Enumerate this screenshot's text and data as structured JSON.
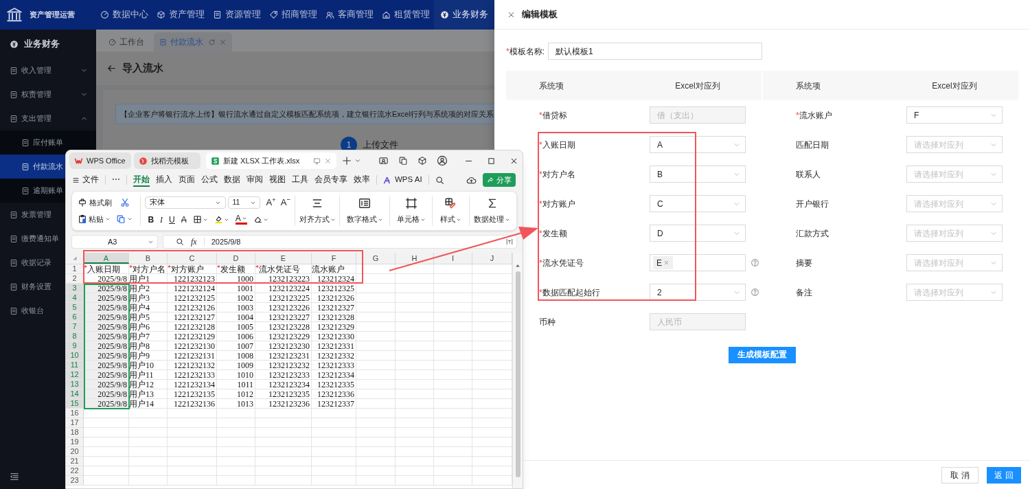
{
  "app": {
    "brand": "资产管理运营",
    "nav": [
      {
        "label": "数据中心",
        "selected": false
      },
      {
        "label": "资产管理",
        "selected": false
      },
      {
        "label": "资源管理",
        "selected": false
      },
      {
        "label": "招商管理",
        "selected": false
      },
      {
        "label": "客商管理",
        "selected": false
      },
      {
        "label": "租赁管理",
        "selected": false
      },
      {
        "label": "业务财务",
        "selected": true
      }
    ],
    "sidebar": {
      "header": "业务财务",
      "items": [
        {
          "label": "收入管理",
          "kind": "group",
          "expanded": false,
          "selected": false
        },
        {
          "label": "权责管理",
          "kind": "group",
          "expanded": false,
          "selected": false
        },
        {
          "label": "支出管理",
          "kind": "group",
          "expanded": true,
          "selected": false,
          "children": [
            {
              "label": "应付账单",
              "selected": false
            },
            {
              "label": "付款流水",
              "selected": true
            },
            {
              "label": "逾期账单",
              "selected": false
            }
          ]
        },
        {
          "label": "发票管理",
          "kind": "leaf",
          "selected": false
        },
        {
          "label": "缴费通知单",
          "kind": "leaf",
          "selected": false
        },
        {
          "label": "收据记录",
          "kind": "leaf",
          "selected": false
        },
        {
          "label": "财务设置",
          "kind": "leaf",
          "selected": false
        },
        {
          "label": "收银台",
          "kind": "leaf",
          "selected": false
        }
      ]
    },
    "tabs": [
      {
        "label": "工作台",
        "selected": false
      },
      {
        "label": "付款流水",
        "selected": true
      }
    ],
    "page_title": "导入流水",
    "notice": "【企业客户将银行流水上传】银行流水通过自定义模板匹配系统项，建立银行流水Excel行列与系统项的对应关系",
    "step": {
      "number": "1",
      "label": "上传文件"
    }
  },
  "wps": {
    "window_tabs": [
      {
        "label": "WPS Office",
        "selected": false
      },
      {
        "label": "找稻壳模板",
        "selected": false
      },
      {
        "label": "新建 XLSX 工作表.xlsx",
        "selected": true
      }
    ],
    "file_menu": "文件",
    "more": "⋯",
    "menu": [
      {
        "label": "开始",
        "selected": true
      },
      {
        "label": "插入",
        "selected": false
      },
      {
        "label": "页面",
        "selected": false
      },
      {
        "label": "公式",
        "selected": false
      },
      {
        "label": "数据",
        "selected": false
      },
      {
        "label": "审阅",
        "selected": false
      },
      {
        "label": "视图",
        "selected": false
      },
      {
        "label": "工具",
        "selected": false
      },
      {
        "label": "会员专享",
        "selected": false
      },
      {
        "label": "效率",
        "selected": false
      }
    ],
    "ai": "WPS AI",
    "share": "分享",
    "ribbon": {
      "format_painter": "格式刷",
      "paste": "粘贴",
      "font": "宋体",
      "size": "11",
      "grow": "A$^{+}$",
      "shrink": "A$^{−}$",
      "style_buttons": [
        {
          "kind": "bold",
          "label": "B"
        },
        {
          "kind": "italic",
          "label": "I"
        },
        {
          "kind": "underline",
          "label": "U"
        },
        {
          "kind": "strike",
          "label": "A"
        }
      ],
      "font_color": "A",
      "groups": [
        "对齐方式",
        "数字格式",
        "单元格",
        "样式",
        "数据处理"
      ]
    },
    "name_box": "A3",
    "fx": "fx",
    "formula": "2025/9/8",
    "columns": [
      {
        "label": "A",
        "selected": true
      },
      {
        "label": "B",
        "selected": false
      },
      {
        "label": "C",
        "selected": false
      },
      {
        "label": "D",
        "selected": false
      },
      {
        "label": "E",
        "selected": false
      },
      {
        "label": "F",
        "selected": false
      },
      {
        "label": "G",
        "selected": false
      },
      {
        "label": "H",
        "selected": false
      },
      {
        "label": "I",
        "selected": false
      },
      {
        "label": "J",
        "selected": false
      }
    ],
    "rows": [
      {
        "number": "1",
        "kind": "header",
        "selected": false,
        "cells": [
          {
            "mark": "*",
            "text": "入账日期"
          },
          {
            "mark": "*",
            "text": "对方户名"
          },
          {
            "mark": "*",
            "text": "对方账户"
          },
          {
            "mark": "*",
            "text": "发生额"
          },
          {
            "mark": "*",
            "text": "流水凭证号"
          },
          {
            "text": "流水账户"
          }
        ]
      },
      {
        "number": "2",
        "kind": "data",
        "selected": false,
        "cells": [
          "2025/9/8",
          "用户1",
          "1221232123",
          "1000",
          "1232123223",
          "123212324"
        ]
      },
      {
        "number": "3",
        "kind": "data",
        "selected": true,
        "cells": [
          "2025/9/8",
          "用户2",
          "1221232124",
          "1001",
          "1232123224",
          "123212325"
        ]
      },
      {
        "number": "4",
        "kind": "data",
        "selected": true,
        "cells": [
          "2025/9/8",
          "用户3",
          "1221232125",
          "1002",
          "1232123225",
          "123212326"
        ]
      },
      {
        "number": "5",
        "kind": "data",
        "selected": true,
        "cells": [
          "2025/9/8",
          "用户4",
          "1221232126",
          "1003",
          "1232123226",
          "123212327"
        ]
      },
      {
        "number": "6",
        "kind": "data",
        "selected": true,
        "cells": [
          "2025/9/8",
          "用户5",
          "1221232127",
          "1004",
          "1232123227",
          "123212328"
        ]
      },
      {
        "number": "7",
        "kind": "data",
        "selected": true,
        "cells": [
          "2025/9/8",
          "用户6",
          "1221232128",
          "1005",
          "1232123228",
          "123212329"
        ]
      },
      {
        "number": "8",
        "kind": "data",
        "selected": true,
        "cells": [
          "2025/9/8",
          "用户7",
          "1221232129",
          "1006",
          "1232123229",
          "123212330"
        ]
      },
      {
        "number": "9",
        "kind": "data",
        "selected": true,
        "cells": [
          "2025/9/8",
          "用户8",
          "1221232130",
          "1007",
          "1232123230",
          "123212331"
        ]
      },
      {
        "number": "10",
        "kind": "data",
        "selected": true,
        "cells": [
          "2025/9/8",
          "用户9",
          "1221232131",
          "1008",
          "1232123231",
          "123212332"
        ]
      },
      {
        "number": "11",
        "kind": "data",
        "selected": true,
        "cells": [
          "2025/9/8",
          "用户10",
          "1221232132",
          "1009",
          "1232123232",
          "123212333"
        ]
      },
      {
        "number": "12",
        "kind": "data",
        "selected": true,
        "cells": [
          "2025/9/8",
          "用户11",
          "1221232133",
          "1010",
          "1232123233",
          "123212334"
        ]
      },
      {
        "number": "13",
        "kind": "data",
        "selected": true,
        "cells": [
          "2025/9/8",
          "用户12",
          "1221232134",
          "1011",
          "1232123234",
          "123212335"
        ]
      },
      {
        "number": "14",
        "kind": "data",
        "selected": true,
        "cells": [
          "2025/9/8",
          "用户13",
          "1221232135",
          "1012",
          "1232123235",
          "123212336"
        ]
      },
      {
        "number": "15",
        "kind": "data",
        "selected": true,
        "cells": [
          "2025/9/8",
          "用户14",
          "1221232136",
          "1013",
          "1232123236",
          "123212337"
        ]
      },
      {
        "number": "16",
        "kind": "empty",
        "selected": false
      },
      {
        "number": "17",
        "kind": "empty",
        "selected": false
      },
      {
        "number": "18",
        "kind": "empty",
        "selected": false
      },
      {
        "number": "19",
        "kind": "empty",
        "selected": false
      },
      {
        "number": "20",
        "kind": "empty",
        "selected": false
      },
      {
        "number": "21",
        "kind": "empty",
        "selected": false
      },
      {
        "number": "22",
        "kind": "empty",
        "selected": false
      },
      {
        "number": "23",
        "kind": "empty",
        "selected": false
      }
    ]
  },
  "drawer": {
    "title": "编辑模板",
    "template_name": {
      "mark": "*",
      "label": "模板名称:",
      "value": "默认模板1"
    },
    "headers": [
      "系统项",
      "Excel对应列",
      "系统项",
      "Excel对应列"
    ],
    "left": [
      {
        "mark": "*",
        "label": "借贷标",
        "kind": "disabled",
        "value": "借（支出）"
      },
      {
        "mark": "*",
        "label": "入账日期",
        "kind": "select",
        "value": "A"
      },
      {
        "mark": "*",
        "label": "对方户名",
        "kind": "select",
        "value": "B"
      },
      {
        "mark": "*",
        "label": "对方账户",
        "kind": "select",
        "value": "C"
      },
      {
        "mark": "*",
        "label": "发生额",
        "kind": "select",
        "value": "D"
      },
      {
        "mark": "*",
        "label": "流水凭证号",
        "kind": "tags",
        "tags": [
          "E"
        ],
        "help": true
      },
      {
        "mark": "*",
        "label": "数据匹配起始行",
        "kind": "select",
        "value": "2",
        "help": true
      },
      {
        "label": "币种",
        "kind": "disabled",
        "value": "人民币"
      }
    ],
    "right": [
      {
        "mark": "*",
        "label": "流水账户",
        "kind": "select",
        "value": "F"
      },
      {
        "label": "匹配日期",
        "kind": "select",
        "placeholder": "请选择对应列"
      },
      {
        "label": "联系人",
        "kind": "select",
        "placeholder": "请选择对应列"
      },
      {
        "label": "开户银行",
        "kind": "select",
        "placeholder": "请选择对应列"
      },
      {
        "label": "汇款方式",
        "kind": "select",
        "placeholder": "请选择对应列"
      },
      {
        "label": "摘要",
        "kind": "select",
        "placeholder": "请选择对应列"
      },
      {
        "label": "备注",
        "kind": "select",
        "placeholder": "请选择对应列"
      }
    ],
    "generate": "生成模板配置",
    "cancel": "取 消",
    "back": "返 回"
  }
}
